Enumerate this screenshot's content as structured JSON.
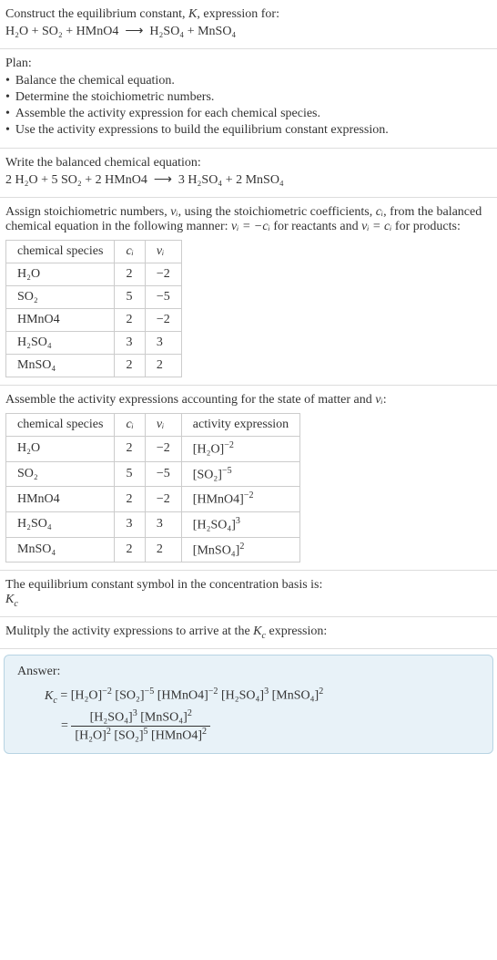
{
  "s1": {
    "intro": "Construct the equilibrium constant, ",
    "kvar": "K",
    "intro2": ", expression for:",
    "eq_lhs": "H₂O + SO₂ + HMnO4",
    "arrow": "⟶",
    "eq_rhs": "H₂SO₄ + MnSO₄"
  },
  "s2": {
    "plan": "Plan:",
    "b1": "Balance the chemical equation.",
    "b2": "Determine the stoichiometric numbers.",
    "b3": "Assemble the activity expression for each chemical species.",
    "b4": "Use the activity expressions to build the equilibrium constant expression."
  },
  "s3": {
    "line": "Write the balanced chemical equation:",
    "eq_lhs": "2 H₂O + 5 SO₂ + 2 HMnO4",
    "arrow": "⟶",
    "eq_rhs": "3 H₂SO₄ + 2 MnSO₄"
  },
  "s4": {
    "p1a": "Assign stoichiometric numbers, ",
    "nu_i": "νᵢ",
    "p1b": ", using the stoichiometric coefficients, ",
    "c_i": "cᵢ",
    "p1c": ", from the balanced chemical equation in the following manner: ",
    "rel1": "νᵢ = −cᵢ",
    "p1d": " for reactants and ",
    "rel2": "νᵢ = cᵢ",
    "p1e": " for products:",
    "h1": "chemical species",
    "h2": "cᵢ",
    "h3": "νᵢ",
    "rows": [
      {
        "sp": "H₂O",
        "c": "2",
        "n": "−2"
      },
      {
        "sp": "SO₂",
        "c": "5",
        "n": "−5"
      },
      {
        "sp": "HMnO4",
        "c": "2",
        "n": "−2"
      },
      {
        "sp": "H₂SO₄",
        "c": "3",
        "n": "3"
      },
      {
        "sp": "MnSO₄",
        "c": "2",
        "n": "2"
      }
    ]
  },
  "s5": {
    "p": "Assemble the activity expressions accounting for the state of matter and ",
    "nu_i": "νᵢ",
    "colon": ":",
    "h1": "chemical species",
    "h2": "cᵢ",
    "h3": "νᵢ",
    "h4": "activity expression",
    "rows": [
      {
        "sp": "H₂O",
        "c": "2",
        "n": "−2",
        "a_base": "[H₂O]",
        "a_exp": "−2"
      },
      {
        "sp": "SO₂",
        "c": "5",
        "n": "−5",
        "a_base": "[SO₂]",
        "a_exp": "−5"
      },
      {
        "sp": "HMnO4",
        "c": "2",
        "n": "−2",
        "a_base": "[HMnO4]",
        "a_exp": "−2"
      },
      {
        "sp": "H₂SO₄",
        "c": "3",
        "n": "3",
        "a_base": "[H₂SO₄]",
        "a_exp": "3"
      },
      {
        "sp": "MnSO₄",
        "c": "2",
        "n": "2",
        "a_base": "[MnSO₄]",
        "a_exp": "2"
      }
    ]
  },
  "s6": {
    "p": "The equilibrium constant symbol in the concentration basis is:",
    "kc": "K",
    "sub": "c"
  },
  "s7": {
    "p": "Mulitply the activity expressions to arrive at the ",
    "kc": "K",
    "sub": "c",
    "p2": " expression:"
  },
  "ans": {
    "label": "Answer:",
    "k": "K",
    "ksub": "c",
    "eq": " = ",
    "t1": "[H₂O]",
    "e1": "−2",
    "t2": "[SO₂]",
    "e2": "−5",
    "t3": "[HMnO4]",
    "e3": "−2",
    "t4": "[H₂SO₄]",
    "e4": "3",
    "t5": "[MnSO₄]",
    "e5": "2",
    "eq2": "= ",
    "num1": "[H₂SO₄]",
    "ne1": "3",
    "num2": "[MnSO₄]",
    "ne2": "2",
    "den1": "[H₂O]",
    "de1": "2",
    "den2": "[SO₂]",
    "de2": "5",
    "den3": "[HMnO4]",
    "de3": "2"
  }
}
